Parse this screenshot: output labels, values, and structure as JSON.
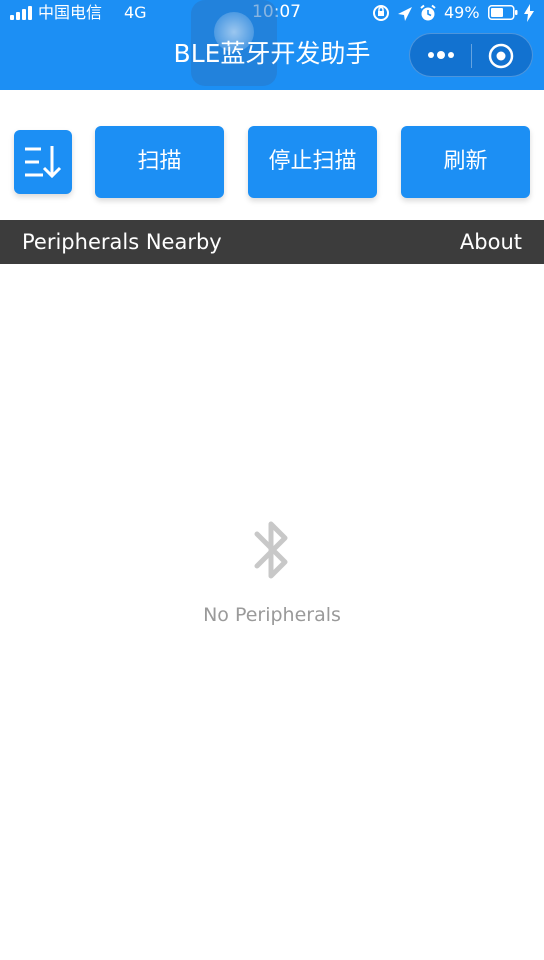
{
  "status_bar": {
    "carrier": "中国电信",
    "network": "4G",
    "time": "10:07",
    "battery_percent": "49%"
  },
  "nav": {
    "title": "BLE蓝牙开发助手"
  },
  "toolbar": {
    "scan_label": "扫描",
    "stop_scan_label": "停止扫描",
    "refresh_label": "刷新"
  },
  "section": {
    "title": "Peripherals Nearby",
    "about_label": "About"
  },
  "empty_state": {
    "message": "No Peripherals"
  },
  "colors": {
    "primary": "#1c8ff4",
    "header_dark": "#3c3c3c",
    "muted_text": "#9a9a9a"
  }
}
